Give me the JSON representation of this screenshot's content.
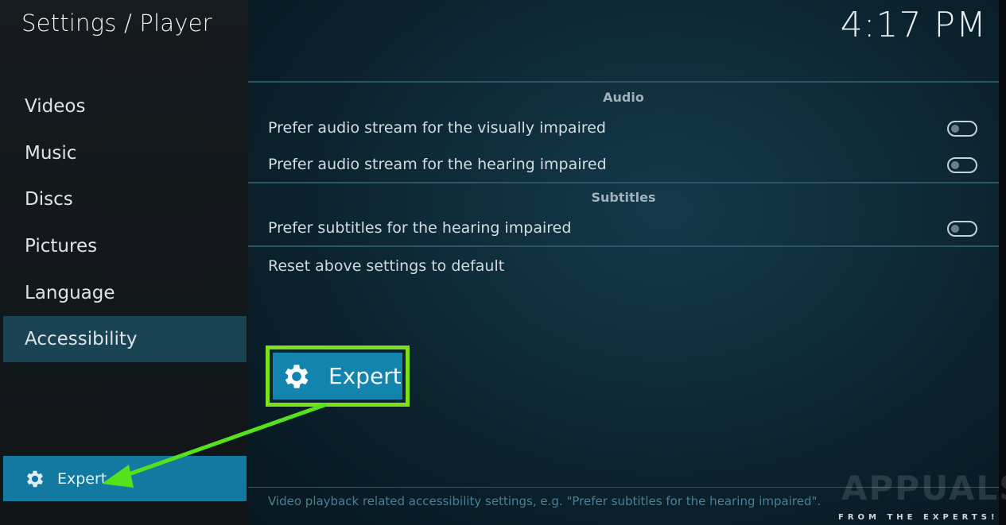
{
  "header": {
    "title": "Settings / Player",
    "clock": "4:17 PM"
  },
  "sidebar": {
    "items": [
      {
        "label": "Videos"
      },
      {
        "label": "Music"
      },
      {
        "label": "Discs"
      },
      {
        "label": "Pictures"
      },
      {
        "label": "Language"
      },
      {
        "label": "Accessibility",
        "active": true
      }
    ],
    "level_button": {
      "label": "Expert",
      "icon": "gear-icon"
    }
  },
  "main": {
    "sections": [
      {
        "title": "Audio",
        "settings": [
          {
            "label": "Prefer audio stream for the visually impaired",
            "enabled": false
          },
          {
            "label": "Prefer audio stream for the hearing impaired",
            "enabled": false
          }
        ]
      },
      {
        "title": "Subtitles",
        "settings": [
          {
            "label": "Prefer subtitles for the hearing impaired",
            "enabled": false
          }
        ]
      }
    ],
    "reset_label": "Reset above settings to default",
    "highlight_button": {
      "label": "Expert",
      "icon": "gear-icon"
    },
    "description": "Video playback related accessibility settings, e.g. \"Prefer subtitles for the hearing impaired\"."
  },
  "watermark": {
    "logo": "APPUALS",
    "tagline": "FROM THE EXPERTS!"
  },
  "colors": {
    "sidebar_bg": "#161b1f",
    "active_item": "#1a4354",
    "level_button": "#127aa0",
    "highlight_border": "#7de01a",
    "arrow": "#55e21c"
  }
}
